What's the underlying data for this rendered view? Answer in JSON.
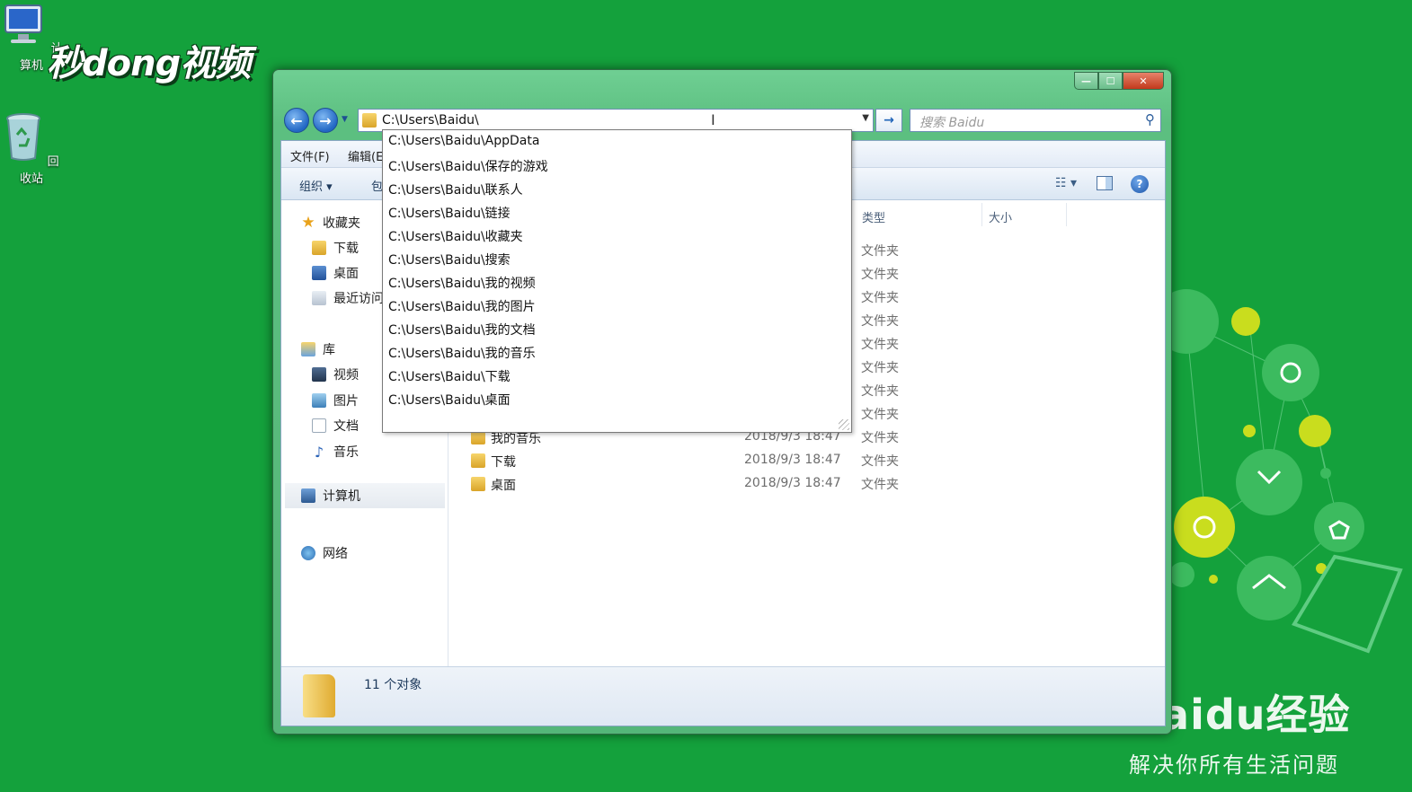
{
  "desktop": {
    "icons": [
      {
        "label": "计算机",
        "icon": "computer-icon"
      },
      {
        "label": "回收站",
        "icon": "recycle-bin-icon"
      }
    ],
    "watermark_top": "秒dong视频",
    "watermark_bottom": {
      "brand": "Baidu经验",
      "slogan": "解决你所有生活问题"
    }
  },
  "window": {
    "address": "C:\\Users\\Baidu\\",
    "search_placeholder": "搜索 Baidu",
    "menu": [
      "文件(F)",
      "编辑(E"
    ],
    "toolbar": {
      "organize": "组织 ▾",
      "include": "包"
    },
    "nav": {
      "favorites": "收藏夹",
      "downloads": "下载",
      "desktop": "桌面",
      "recent": "最近访问",
      "libraries": "库",
      "videos": "视频",
      "pictures": "图片",
      "documents": "文档",
      "music": "音乐",
      "computer": "计算机",
      "network": "网络"
    },
    "columns": {
      "type": "类型",
      "size": "大小"
    },
    "row_types": [
      "文件夹",
      "文件夹",
      "文件夹",
      "文件夹",
      "文件夹",
      "文件夹",
      "文件夹",
      "文件夹",
      "文件夹",
      "文件夹",
      "文件夹"
    ],
    "visible_rows": [
      {
        "name": "我的音乐",
        "date": "2018/9/3 18:47"
      },
      {
        "name": "下载",
        "date": "2018/9/3 18:47"
      },
      {
        "name": "桌面",
        "date": "2018/9/3 18:47"
      }
    ],
    "status": "11 个对象"
  },
  "autocomplete": [
    "C:\\Users\\Baidu\\AppData",
    "C:\\Users\\Baidu\\保存的游戏",
    "C:\\Users\\Baidu\\联系人",
    "C:\\Users\\Baidu\\链接",
    "C:\\Users\\Baidu\\收藏夹",
    "C:\\Users\\Baidu\\搜索",
    "C:\\Users\\Baidu\\我的视频",
    "C:\\Users\\Baidu\\我的图片",
    "C:\\Users\\Baidu\\我的文档",
    "C:\\Users\\Baidu\\我的音乐",
    "C:\\Users\\Baidu\\下载",
    "C:\\Users\\Baidu\\桌面"
  ],
  "colors": {
    "desktop_bg": "#14a13c",
    "window_frame": "#5cbf80",
    "accent_blue": "#2267c4"
  }
}
